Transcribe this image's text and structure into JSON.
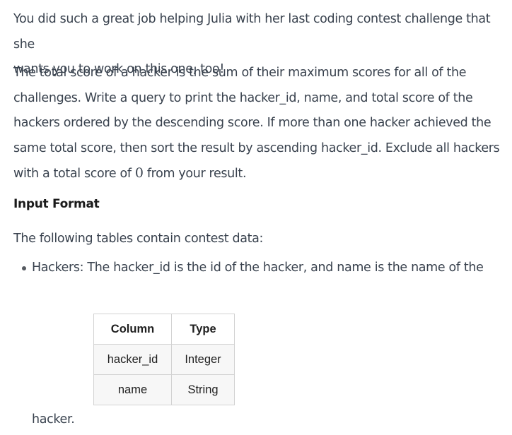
{
  "intro": {
    "line1": "You did such a great job helping Julia with her last coding contest challenge that she",
    "line2": "wants you to work on this one, too!"
  },
  "description": {
    "line1": "The total score of a hacker is the sum of their maximum scores for all of the",
    "line2": "challenges. Write a query to print the hacker_id, name, and total score of the",
    "line3": "hackers ordered by the descending score. If more than one hacker achieved the",
    "line4": "same total score, then sort the result by ascending hacker_id. Exclude all hackers",
    "line5_before": "with a total score of ",
    "line5_number": "0",
    "line5_after": " from your result."
  },
  "input_format": {
    "heading": "Input Format",
    "intro": "The following tables contain contest data:",
    "bullet_text": "Hackers: The hacker_id is the id of the hacker, and name is the name of the",
    "bullet_tail": "hacker.",
    "table": {
      "headers": [
        "Column",
        "Type"
      ],
      "rows": [
        [
          "hacker_id",
          "Integer"
        ],
        [
          "name",
          "String"
        ]
      ]
    }
  }
}
